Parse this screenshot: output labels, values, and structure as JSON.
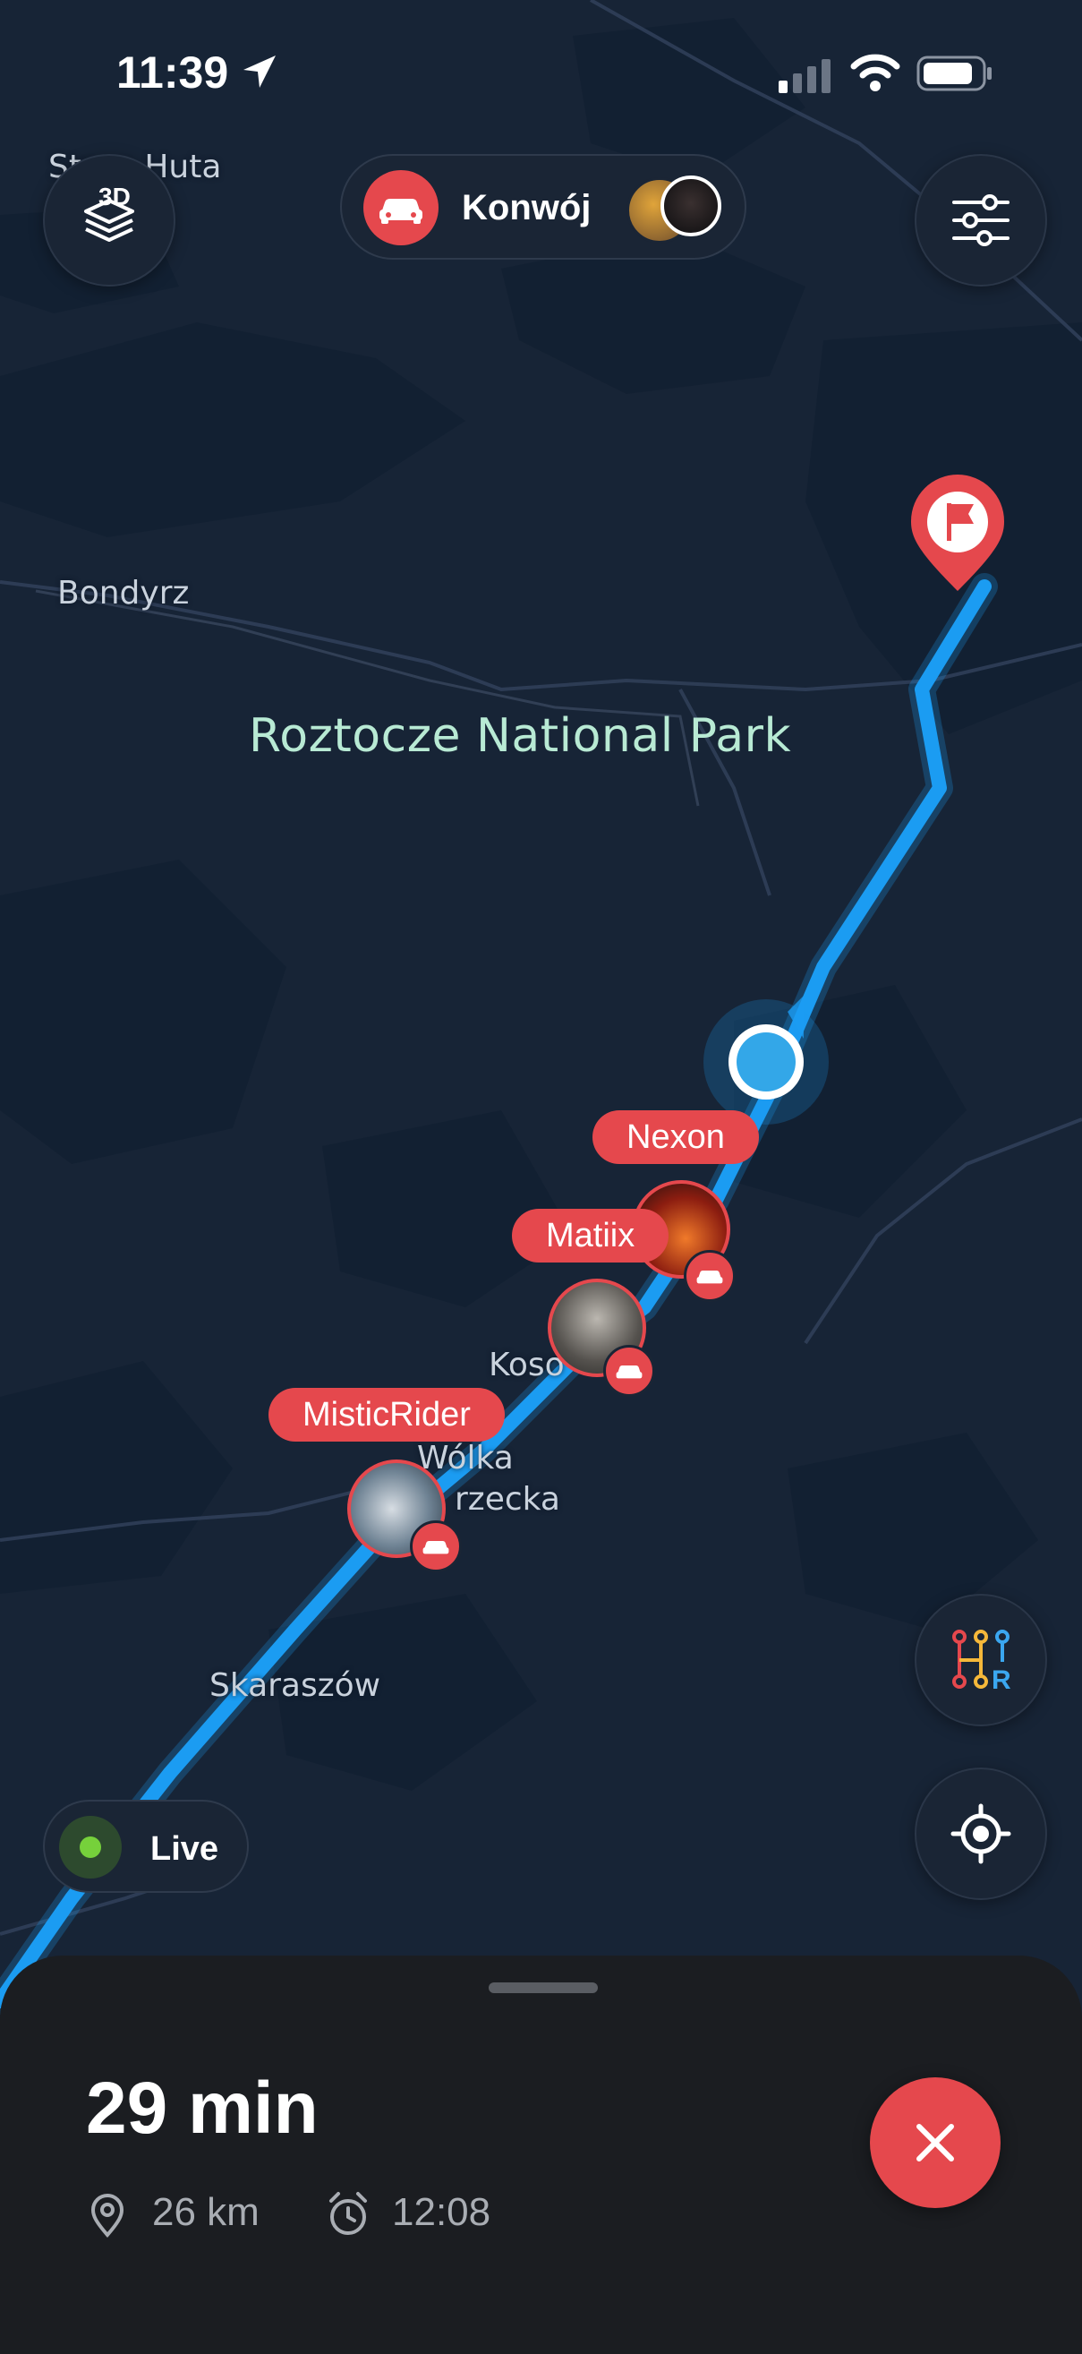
{
  "status_bar": {
    "time": "11:39"
  },
  "map_labels": {
    "top_left_place": "Stara Huta",
    "bondyrz": "Bondyrz",
    "park": "Roztocze National Park",
    "kosobudy": "Koso",
    "wolka_1": "Wólka",
    "wolka_2": "rzecka",
    "skaraszow": "Skaraszów"
  },
  "toolbar": {
    "view_mode_badge": "3D",
    "convoy_label": "Konwój",
    "filters_icon": "sliders-icon"
  },
  "convoy_members": [
    {
      "name": "Nexon",
      "icon": "car-icon"
    },
    {
      "name": "Matiix",
      "icon": "car-icon"
    },
    {
      "name": "MisticRider",
      "icon": "car-icon"
    }
  ],
  "live": {
    "label": "Live",
    "indicator_color": "#76d13b"
  },
  "bottom_sheet": {
    "eta": "29 min",
    "distance": "26 km",
    "arrival_time": "12:08"
  },
  "colors": {
    "accent_red": "#e5484d",
    "route_blue": "#1b9cf2",
    "map_background": "#172436"
  }
}
